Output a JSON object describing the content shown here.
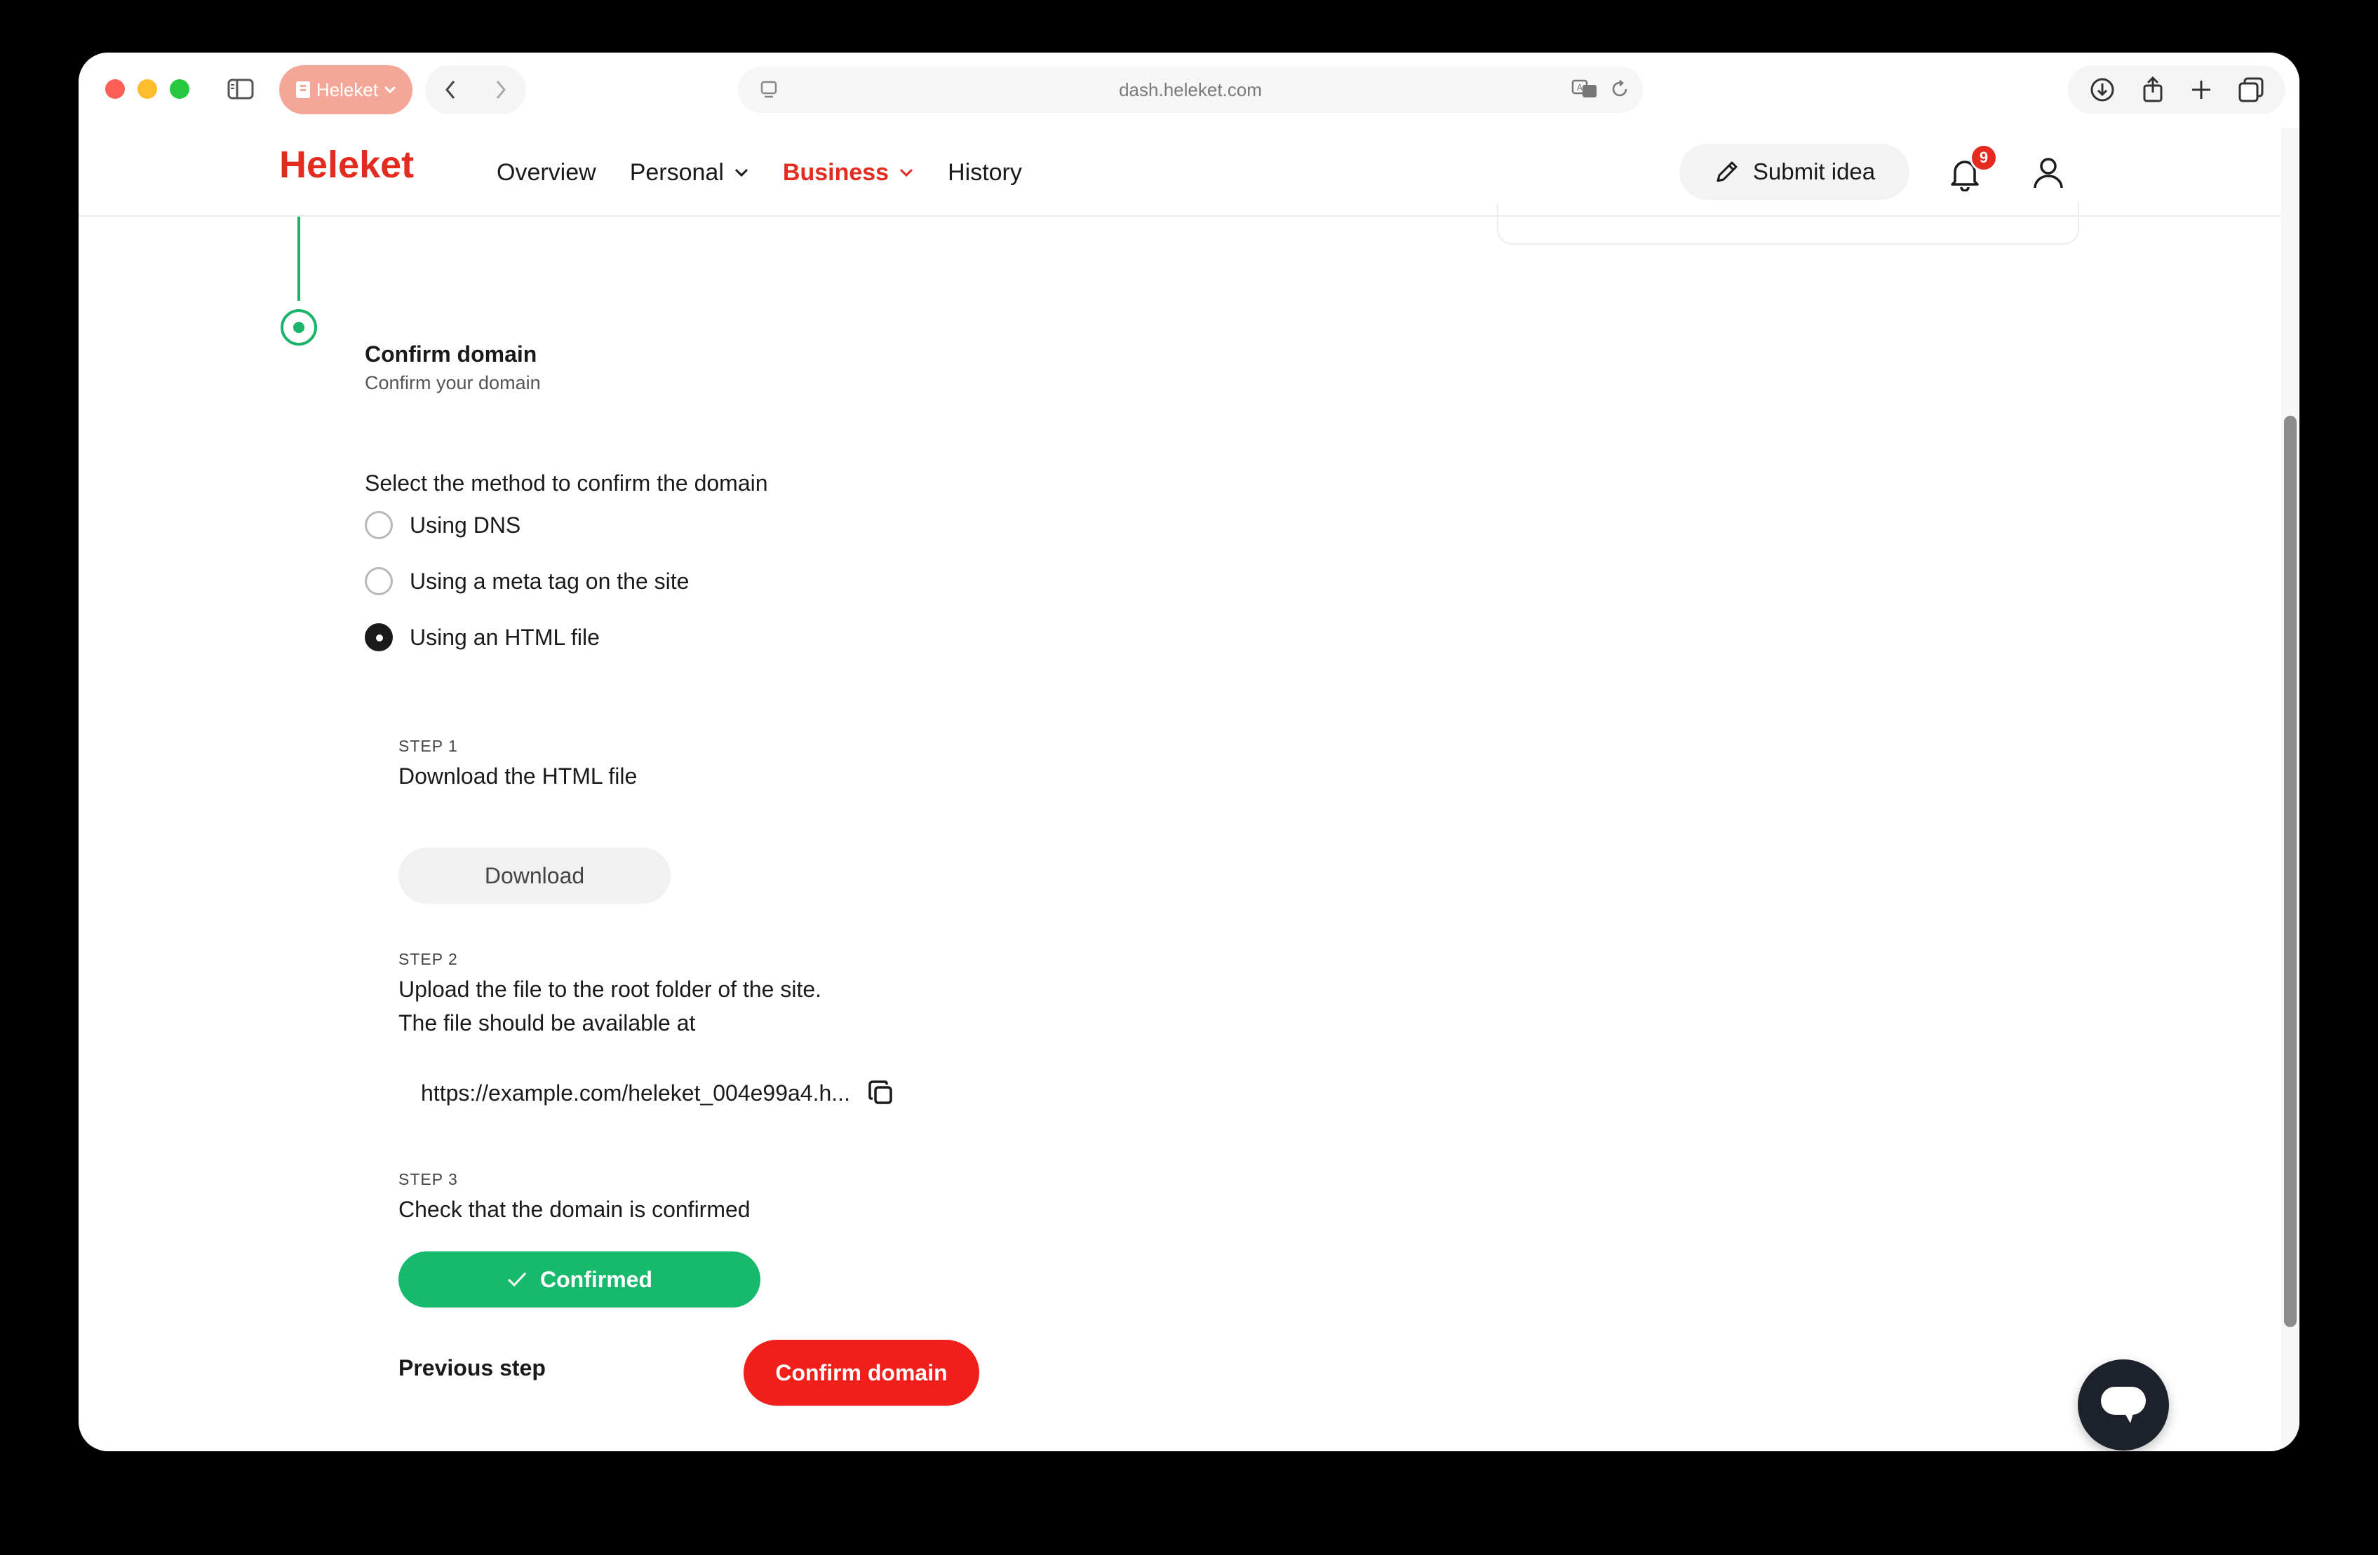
{
  "browser": {
    "tab_label": "Heleket",
    "url": "dash.heleket.com"
  },
  "header": {
    "logo": "Heleket",
    "nav": [
      {
        "label": "Overview"
      },
      {
        "label": "Personal"
      },
      {
        "label": "Business"
      },
      {
        "label": "History"
      }
    ],
    "submit_idea_label": "Submit idea",
    "notification_count": "9"
  },
  "step": {
    "title": "Confirm domain",
    "subtitle": "Confirm your domain"
  },
  "methods": {
    "label": "Select the method to confirm the domain",
    "options": [
      {
        "label": "Using DNS",
        "selected": false
      },
      {
        "label": "Using a meta tag on the site",
        "selected": false
      },
      {
        "label": "Using an HTML file",
        "selected": true
      }
    ]
  },
  "steps": {
    "s1": {
      "tag": "STEP 1",
      "title": "Download the HTML file",
      "button": "Download"
    },
    "s2": {
      "tag": "STEP 2",
      "title": "Upload the file to the root folder of the site.",
      "text": "The file should be available at",
      "url": "https://example.com/heleket_004e99a4.h..."
    },
    "s3": {
      "tag": "STEP 3",
      "title": "Check that the domain is confirmed",
      "status": "Confirmed"
    }
  },
  "actions": {
    "previous": "Previous step",
    "confirm": "Confirm domain"
  },
  "colors": {
    "brand_red": "#e32b1f",
    "success_green": "#17b96c",
    "timeline_green": "#1cb36a"
  }
}
